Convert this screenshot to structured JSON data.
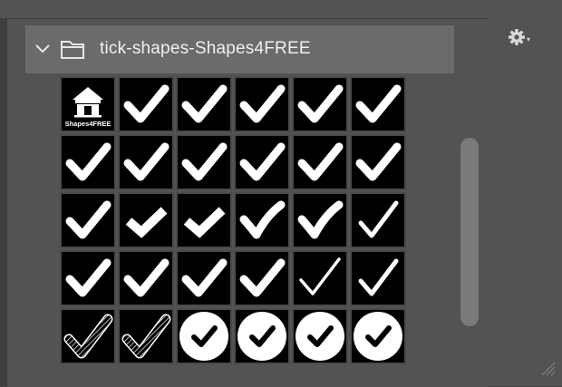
{
  "group": {
    "title": "tick-shapes-Shapes4FREE",
    "expanded": true
  },
  "logo": {
    "caption": "Shapes4FREE"
  },
  "tiles": [
    "logo",
    "tick-bold",
    "tick-bold",
    "tick-bold",
    "tick-bold",
    "tick-bold",
    "tick-bold",
    "tick-bold",
    "tick-bold",
    "tick-bold",
    "tick-bold",
    "tick-bold",
    "tick-bold",
    "tick-chevron",
    "tick-chevron",
    "tick-brush",
    "tick-brush",
    "tick-thin",
    "tick-bold",
    "tick-bold",
    "tick-bold",
    "tick-bold",
    "tick-outline",
    "tick-thin",
    "tick-hatched",
    "tick-hatched",
    "tick-circle",
    "tick-circle",
    "tick-circle",
    "tick-circle"
  ],
  "colors": {
    "panel": "#535353",
    "header": "#6b6b6b",
    "tile": "#000000",
    "mark": "#ffffff"
  },
  "icons": {
    "gear": "gear-icon",
    "collapse": "chevron-down-icon",
    "folder": "folder-icon",
    "resize": "resize-grip-icon"
  }
}
